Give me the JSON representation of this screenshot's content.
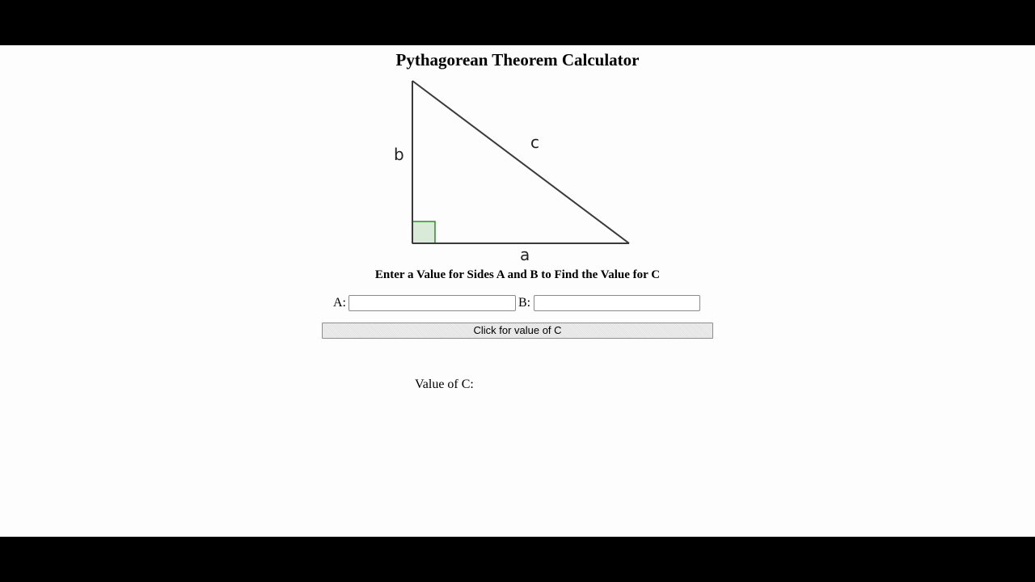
{
  "page": {
    "title": "Pythagorean Theorem Calculator",
    "instructions": "Enter a Value for Sides A and B to Find the Value for C"
  },
  "diagram": {
    "side_a_label": "a",
    "side_b_label": "b",
    "side_c_label": "c",
    "right_angle_color": "#2e8b2e"
  },
  "form": {
    "a_label": "A:",
    "a_value": "",
    "b_label": "B:",
    "b_value": "",
    "button_label": "Click for value of C"
  },
  "result": {
    "label": "Value of C:",
    "value": ""
  }
}
